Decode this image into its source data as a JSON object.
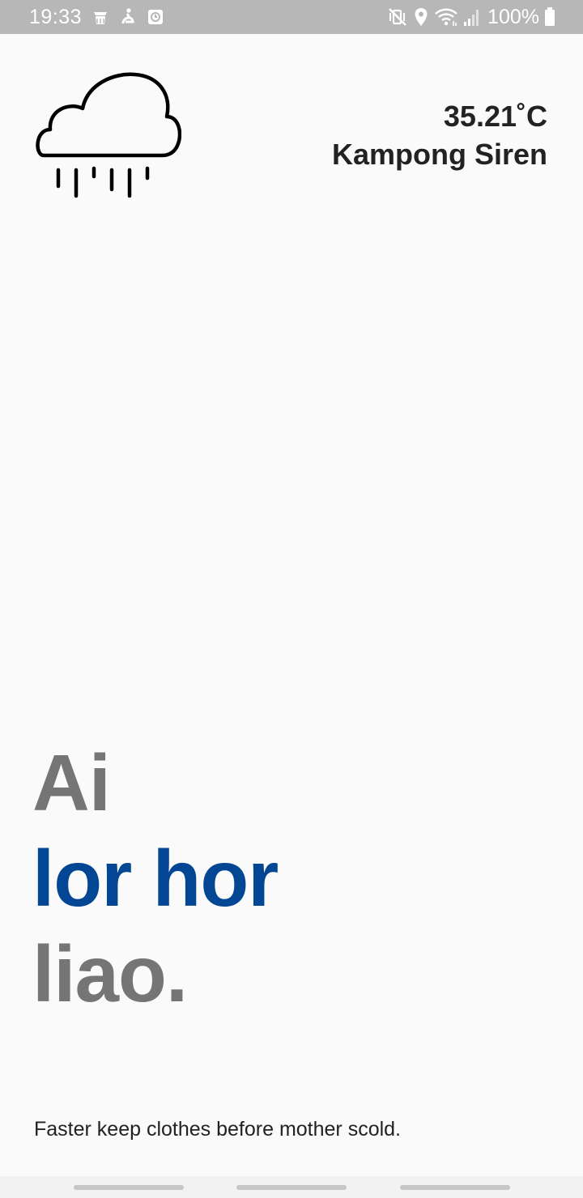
{
  "status_bar": {
    "time": "19:33",
    "left_icons": [
      "android-debug-icon",
      "accessibility-icon",
      "screen-record-icon"
    ],
    "right_icons": [
      "mute-vibrate-icon",
      "location-icon",
      "wifi-icon",
      "signal-icon"
    ],
    "battery_text": "100%"
  },
  "weather": {
    "icon": "rain-cloud-icon",
    "temperature": "35.21",
    "unit": "˚C",
    "location": "Kampong Siren"
  },
  "headline": {
    "line1": "Ai",
    "line2": "lor hor",
    "line3": "liao."
  },
  "tagline": "Faster keep clothes before mother scold.",
  "colors": {
    "accent_blue": "#034694",
    "headline_grey": "#757575",
    "text_dark": "#222222",
    "background": "#fafafa",
    "status_bar": "#b7b7b7"
  }
}
